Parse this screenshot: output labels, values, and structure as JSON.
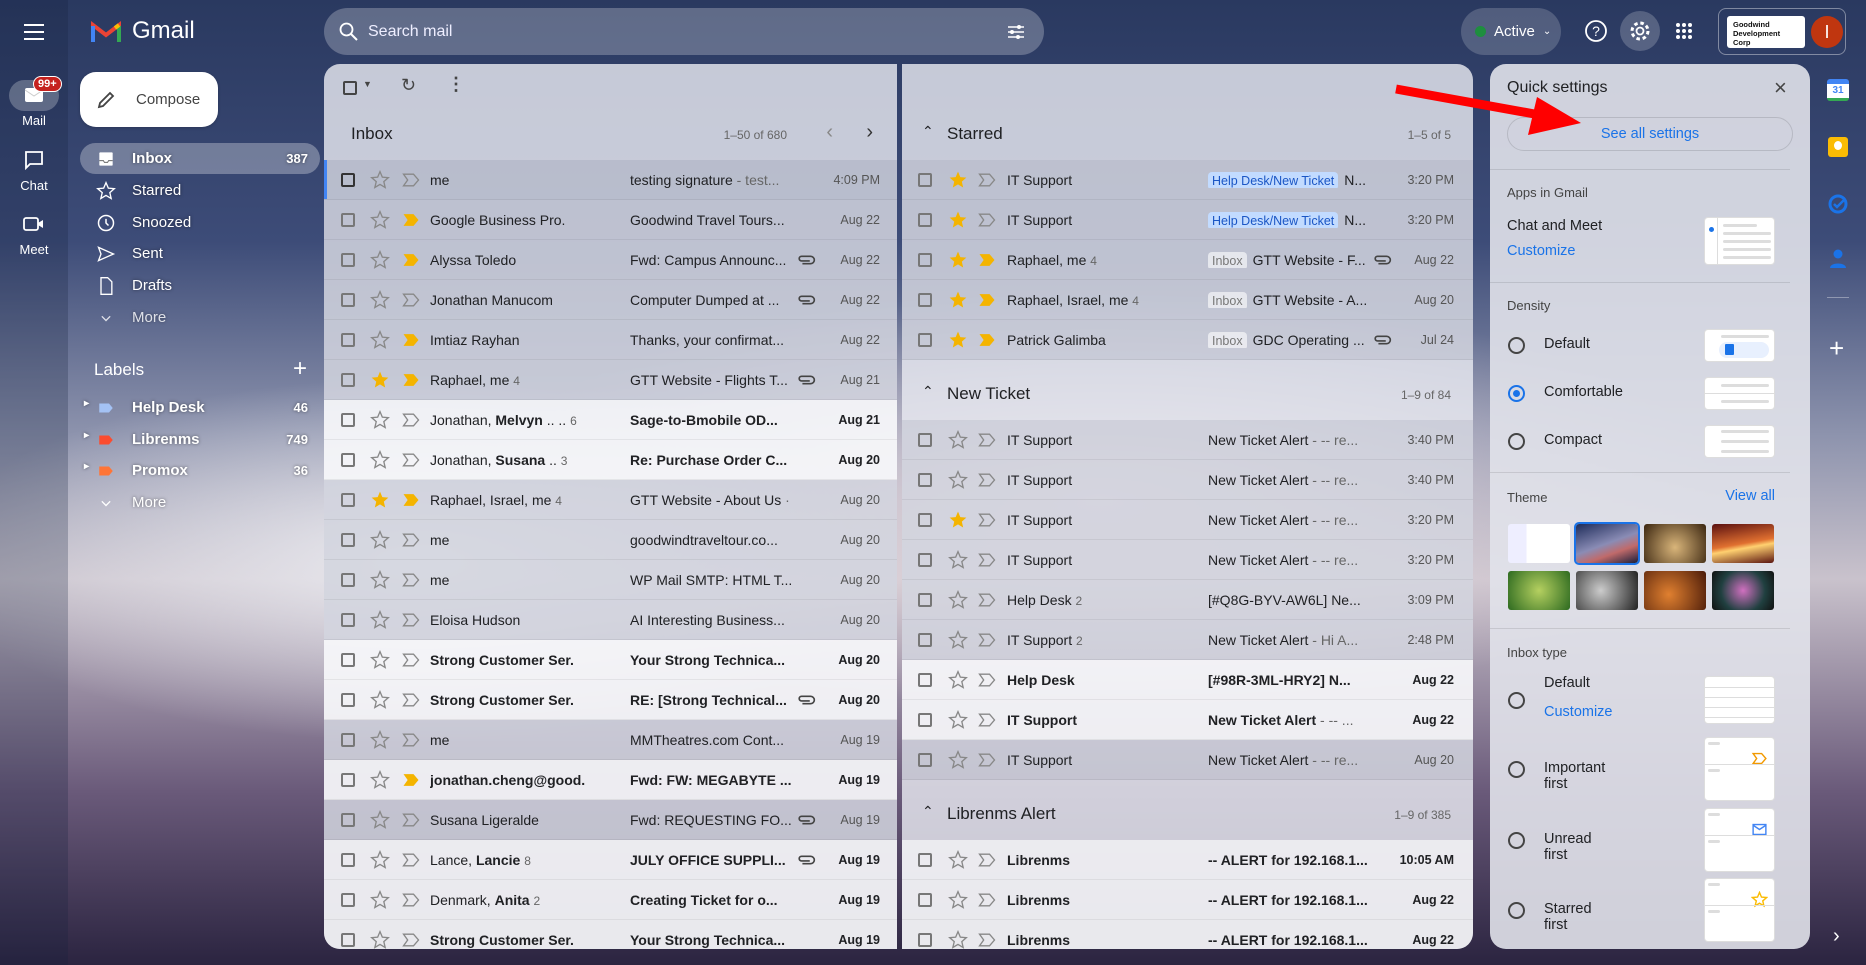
{
  "app": {
    "name": "Gmail"
  },
  "rail": {
    "mail_label": "Mail",
    "mail_badge": "99+",
    "chat_label": "Chat",
    "meet_label": "Meet"
  },
  "search": {
    "placeholder": "Search mail"
  },
  "header": {
    "status": "Active",
    "status_color": "#1e8e3e",
    "org_name": "Goodwind Development Corp",
    "avatar_initial": "I",
    "avatar_color": "#c0360f"
  },
  "compose": {
    "label": "Compose"
  },
  "nav": [
    {
      "label": "Inbox",
      "count": "387",
      "icon": "inbox-icon",
      "active": true
    },
    {
      "label": "Starred",
      "count": "",
      "icon": "star-icon"
    },
    {
      "label": "Snoozed",
      "count": "",
      "icon": "clock-icon"
    },
    {
      "label": "Sent",
      "count": "",
      "icon": "send-icon"
    },
    {
      "label": "Drafts",
      "count": "",
      "icon": "draft-icon"
    },
    {
      "label": "More",
      "count": "",
      "icon": "chevron-down-icon"
    }
  ],
  "labels": {
    "title": "Labels",
    "items": [
      {
        "label": "Help Desk",
        "count": "46",
        "color": "#a4c2f4"
      },
      {
        "label": "Librenms",
        "count": "749",
        "color": "#fb4c2f"
      },
      {
        "label": "Promox",
        "count": "36",
        "color": "#ff7537"
      }
    ],
    "more": "More"
  },
  "inbox": {
    "title": "Inbox",
    "range": "1–50 of 680",
    "rows": [
      {
        "from": "me",
        "subject": "testing signature",
        "snippet": " - test...",
        "date": "4:09 PM",
        "important": "outline",
        "selected": true
      },
      {
        "from": "Google Business Pro.",
        "subject": "Goodwind Travel Tours...",
        "date": "Aug 22",
        "important": "filled"
      },
      {
        "from": "Alyssa Toledo",
        "subject": "Fwd: Campus Announc...",
        "date": "Aug 22",
        "important": "filled",
        "attachment": true
      },
      {
        "from": "Jonathan Manucom",
        "subject": "Computer Dumped at ...",
        "date": "Aug 22",
        "important": "outline",
        "attachment": true
      },
      {
        "from": "Imtiaz Rayhan",
        "subject": "Thanks, your confirmat...",
        "date": "Aug 22",
        "important": "filled"
      },
      {
        "from": "Raphael, me",
        "count": "4",
        "subject": "GTT Website - Flights T...",
        "date": "Aug 21",
        "important": "filled",
        "starred": true,
        "attachment": true
      },
      {
        "from": "Jonathan, ",
        "from_bold": "Melvyn",
        "from_suffix": " .. ..",
        "count": "6",
        "subject": "Sage-to-Bmobile OD...",
        "date": "Aug 21",
        "important": "outline",
        "unread": true
      },
      {
        "from": "Jonathan, ",
        "from_bold": "Susana",
        "from_suffix": " ..",
        "count": "3",
        "subject": "Re: Purchase Order C...",
        "date": "Aug 20",
        "important": "outline",
        "unread": true
      },
      {
        "from": "Raphael, Israel, me",
        "count": "4",
        "subject": "GTT Website - About Us",
        "snippet": " ·",
        "date": "Aug 20",
        "important": "filled",
        "starred": true
      },
      {
        "from": "me",
        "subject": "goodwindtraveltour.co...",
        "date": "Aug 20",
        "important": "outline"
      },
      {
        "from": "me",
        "subject": "WP Mail SMTP: HTML T...",
        "date": "Aug 20",
        "important": "outline"
      },
      {
        "from": "Eloisa Hudson",
        "subject": "AI Interesting Business...",
        "date": "Aug 20",
        "important": "outline"
      },
      {
        "from": "Strong Customer Ser.",
        "subject": "Your Strong Technica...",
        "date": "Aug 20",
        "important": "outline",
        "unread": true
      },
      {
        "from": "Strong Customer Ser.",
        "subject": "RE: [Strong Technical...",
        "date": "Aug 20",
        "important": "outline",
        "unread": true,
        "attachment": true
      },
      {
        "from": "me",
        "subject": "MMTheatres.com Cont...",
        "date": "Aug 19",
        "important": "outline"
      },
      {
        "from": "jonathan.cheng@good.",
        "subject": "Fwd: FW: MEGABYTE ...",
        "date": "Aug 19",
        "important": "filled",
        "unread": true
      },
      {
        "from": "Susana Ligeralde",
        "subject": "Fwd: REQUESTING FO...",
        "date": "Aug 19",
        "important": "outline",
        "attachment": true
      },
      {
        "from": "Lance, ",
        "from_bold": "Lancie",
        "count": "8",
        "subject": "JULY OFFICE SUPPLI...",
        "date": "Aug 19",
        "important": "outline",
        "unread": true,
        "attachment": true
      },
      {
        "from": "Denmark, ",
        "from_bold": "Anita",
        "count": "2",
        "subject": "Creating Ticket for o...",
        "date": "Aug 19",
        "important": "outline",
        "unread": true
      },
      {
        "from": "Strong Customer Ser.",
        "subject": "Your Strong Technica...",
        "date": "Aug 19",
        "important": "outline",
        "unread": true
      }
    ]
  },
  "sections": [
    {
      "title": "Starred",
      "range": "1–5 of 5",
      "rows": [
        {
          "from": "IT Support",
          "chip": "Help Desk/New Ticket",
          "chip_style": "blue",
          "subject": "N...",
          "date": "3:20 PM",
          "important": "outline",
          "starred": true
        },
        {
          "from": "IT Support",
          "chip": "Help Desk/New Ticket",
          "chip_style": "blue",
          "subject": "N...",
          "date": "3:20 PM",
          "important": "outline",
          "starred": true
        },
        {
          "from": "Raphael, me",
          "count": "4",
          "chip": "Inbox",
          "chip_style": "grey",
          "subject": "GTT Website - F...",
          "date": "Aug 22",
          "important": "filled",
          "starred": true,
          "attachment": true
        },
        {
          "from": "Raphael, Israel, me",
          "count": "4",
          "chip": "Inbox",
          "chip_style": "grey",
          "subject": "GTT Website - A...",
          "date": "Aug 20",
          "important": "filled",
          "starred": true
        },
        {
          "from": "Patrick Galimba",
          "chip": "Inbox",
          "chip_style": "grey",
          "subject": "GDC Operating ...",
          "date": "Jul 24",
          "important": "filled",
          "starred": true,
          "attachment": true
        }
      ]
    },
    {
      "title": "New Ticket",
      "range": "1–9 of 84",
      "rows": [
        {
          "from": "IT Support",
          "subject": "New Ticket Alert",
          "snippet": " - -- re...",
          "date": "3:40 PM",
          "important": "outline"
        },
        {
          "from": "IT Support",
          "subject": "New Ticket Alert",
          "snippet": " - -- re...",
          "date": "3:40 PM",
          "important": "outline"
        },
        {
          "from": "IT Support",
          "subject": "New Ticket Alert",
          "snippet": " - -- re...",
          "date": "3:20 PM",
          "important": "outline",
          "starred": true
        },
        {
          "from": "IT Support",
          "subject": "New Ticket Alert",
          "snippet": " - -- re...",
          "date": "3:20 PM",
          "important": "outline"
        },
        {
          "from": "Help Desk",
          "count": "2",
          "subject": "[#Q8G-BYV-AW6L] Ne...",
          "date": "3:09 PM",
          "important": "outline"
        },
        {
          "from": "IT Support",
          "count": "2",
          "subject": "New Ticket Alert",
          "snippet": " - Hi A...",
          "date": "2:48 PM",
          "important": "outline"
        },
        {
          "from": "Help Desk",
          "subject": "[#98R-3ML-HRY2] N...",
          "date": "Aug 22",
          "important": "outline",
          "unread": true
        },
        {
          "from": "IT Support",
          "subject": "New Ticket Alert",
          "snippet": " - -- ...",
          "date": "Aug 22",
          "important": "outline",
          "unread": true
        },
        {
          "from": "IT Support",
          "subject": "New Ticket Alert",
          "snippet": " - -- re...",
          "date": "Aug 20",
          "important": "outline"
        }
      ]
    },
    {
      "title": "Librenms Alert",
      "range": "1–9 of 385",
      "rows": [
        {
          "from": "Librenms",
          "subject": "-- ALERT for 192.168.1...",
          "date": "10:05 AM",
          "important": "outline",
          "unread": true
        },
        {
          "from": "Librenms",
          "subject": "-- ALERT for 192.168.1...",
          "date": "Aug 22",
          "important": "outline",
          "unread": true
        },
        {
          "from": "Librenms",
          "subject": "-- ALERT for 192.168.1...",
          "date": "Aug 22",
          "important": "outline",
          "unread": true
        }
      ]
    }
  ],
  "quick_settings": {
    "title": "Quick settings",
    "see_all": "See all settings",
    "apps_heading": "Apps in Gmail",
    "chat_meet": "Chat and Meet",
    "customize": "Customize",
    "density_heading": "Density",
    "density_options": [
      "Default",
      "Comfortable",
      "Compact"
    ],
    "density_selected": "Comfortable",
    "theme_heading": "Theme",
    "view_all": "View all",
    "theme_selected_index": 1,
    "inbox_type_heading": "Inbox type",
    "inbox_options": [
      "Default",
      "Important first",
      "Unread first",
      "Starred first"
    ],
    "inbox_customize": "Customize"
  },
  "colors": {
    "accent": "#1a73e8",
    "star": "#f4b400",
    "important": "#f4b400",
    "annotation_arrow": "#ff0000"
  }
}
